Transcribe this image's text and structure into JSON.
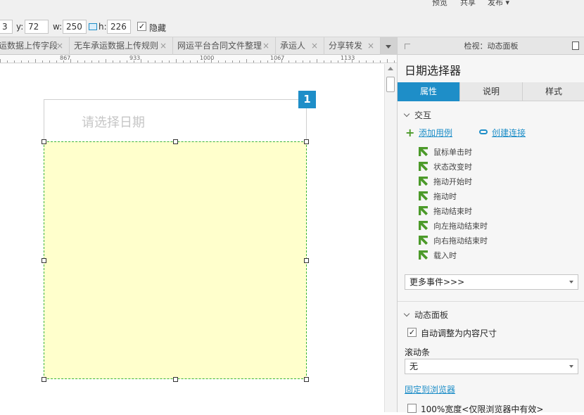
{
  "top_menu": {
    "preview": "预览",
    "share": "共享",
    "publish": "发布 ▾"
  },
  "toolbar": {
    "x_value": "3",
    "y_label": "y:",
    "y_value": "72",
    "w_label": "w:",
    "w_value": "250",
    "h_label": "h:",
    "h_value": "226",
    "hidden_checkbox": "✓",
    "hidden_label": "隐藏"
  },
  "tabs": [
    {
      "label": "运数据上传字段"
    },
    {
      "label": "无车承运数据上传规则"
    },
    {
      "label": "网运平台合同文件整理"
    },
    {
      "label": "承运人"
    },
    {
      "label": "分享转发"
    }
  ],
  "tab_close": "×",
  "ruler": {
    "labels": [
      "867",
      "933",
      "1000",
      "1067",
      "1133"
    ]
  },
  "canvas": {
    "placeholder": "请选择日期",
    "badge": "1"
  },
  "inspector": {
    "header": "检视：动态面板",
    "title": "日期选择器",
    "tabs": [
      "属性",
      "说明",
      "样式"
    ],
    "interaction_header": "交互",
    "add_case": "添加用例",
    "create_link": "创建连接",
    "events": [
      "鼠标单击时",
      "状态改变时",
      "拖动开始时",
      "拖动时",
      "拖动结束时",
      "向左拖动结束时",
      "向右拖动结束时",
      "载入时"
    ],
    "more_events": "更多事件>>>",
    "dynpanel_header": "动态面板",
    "auto_fit_check": "✓",
    "auto_fit_label": "自动调整为内容尺寸",
    "scrollbar_label": "滚动条",
    "scrollbar_value": "无",
    "pin_link": "固定到浏览器",
    "full_width_label": "100%宽度<仅限浏览器中有效>"
  },
  "colors": {
    "accent": "#1e8ec8",
    "panel_fill": "#ffffcc",
    "selection_dash": "#3ab53a",
    "event_icon": "#4c9a2a"
  }
}
